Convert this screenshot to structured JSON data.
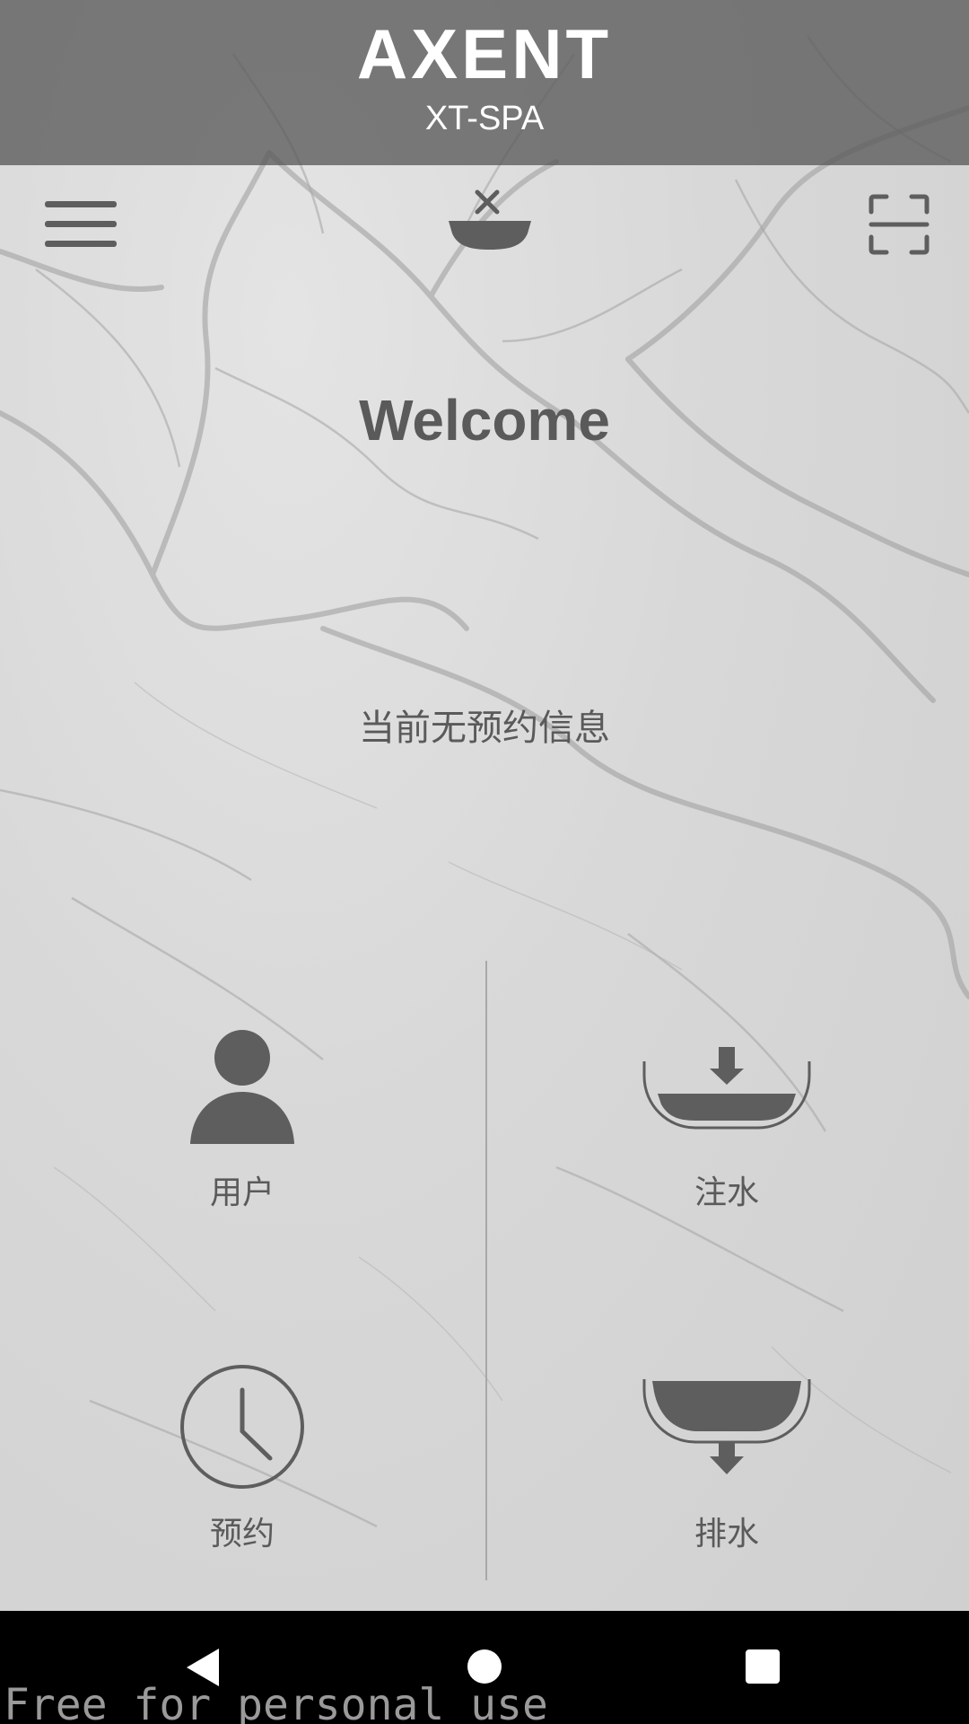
{
  "header": {
    "brand": "AXENT",
    "model": "XT-SPA"
  },
  "toolbar": {
    "menu_icon": "hamburger-menu-icon",
    "status_icon": "bathtub-disconnected-icon",
    "scan_icon": "scan-frame-icon"
  },
  "main": {
    "welcome": "Welcome",
    "reservation_status": "当前无预约信息"
  },
  "tiles": [
    {
      "label": "用户",
      "icon": "user-icon"
    },
    {
      "label": "注水",
      "icon": "fill-water-icon"
    },
    {
      "label": "预约",
      "icon": "clock-icon"
    },
    {
      "label": "排水",
      "icon": "drain-water-icon"
    }
  ],
  "navbar": {
    "back_icon": "back-triangle-icon",
    "home_icon": "home-circle-icon",
    "recent_icon": "recent-square-icon"
  },
  "watermark": "Free for personal use",
  "colors": {
    "header_bg": "#5a5a5a",
    "icon": "#5e5e5e",
    "text": "#5a5a5a",
    "navbar": "#000000"
  }
}
